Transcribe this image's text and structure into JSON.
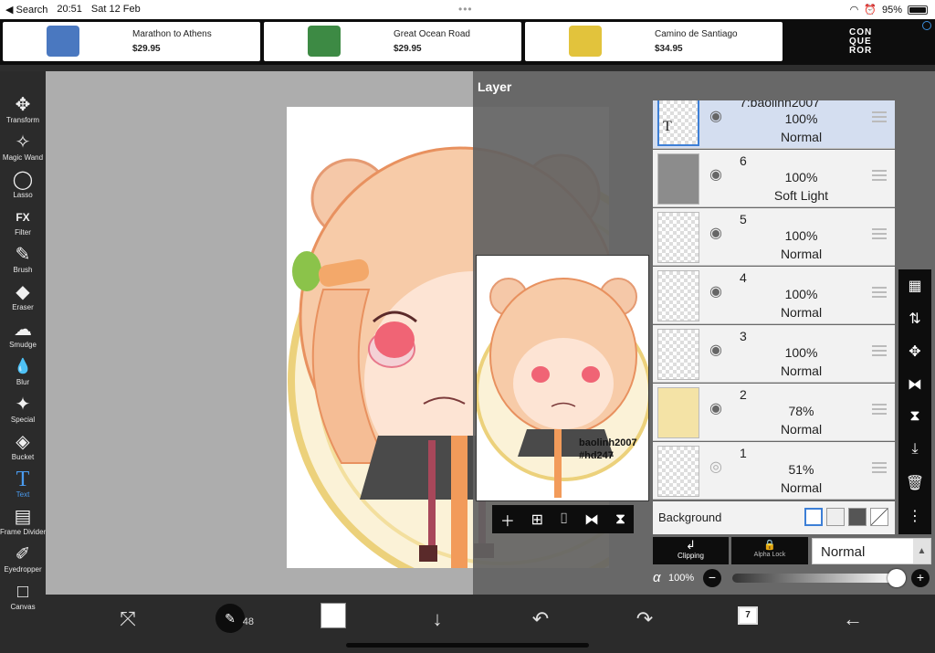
{
  "status_bar": {
    "back": "◀ Search",
    "time": "20:51",
    "date": "Sat 12 Feb",
    "battery": "95%"
  },
  "ads": [
    {
      "title": "Marathon to Athens",
      "price": "$29.95",
      "color": "#4a78c0"
    },
    {
      "title": "Great Ocean Road",
      "price": "$29.95",
      "color": "#3d8a44"
    },
    {
      "title": "Camino de Santiago",
      "price": "$34.95",
      "color": "#e2c33c"
    }
  ],
  "ad_brand": "CON QUE ROR",
  "tools": [
    {
      "label": "Transform",
      "icon": "✥"
    },
    {
      "label": "Magic Wand",
      "icon": "✧"
    },
    {
      "label": "Lasso",
      "icon": "◯"
    },
    {
      "label": "Filter",
      "icon": "FX"
    },
    {
      "label": "Brush",
      "icon": "✎"
    },
    {
      "label": "Eraser",
      "icon": "◆"
    },
    {
      "label": "Smudge",
      "icon": "☁"
    },
    {
      "label": "Blur",
      "icon": "💧"
    },
    {
      "label": "Special",
      "icon": "✦"
    },
    {
      "label": "Bucket",
      "icon": "◈"
    },
    {
      "label": "Text",
      "icon": "T"
    },
    {
      "label": "Frame Divider",
      "icon": "▤"
    },
    {
      "label": "Eyedropper",
      "icon": "✐"
    },
    {
      "label": "Canvas",
      "icon": "□"
    }
  ],
  "layer_panel": {
    "title": "Layer",
    "layers": [
      {
        "name": "7:baolinh2007",
        "opacity": "100%",
        "blend": "Normal",
        "selected": true
      },
      {
        "name": "6",
        "opacity": "100%",
        "blend": "Soft Light",
        "selected": false
      },
      {
        "name": "5",
        "opacity": "100%",
        "blend": "Normal",
        "selected": false
      },
      {
        "name": "4",
        "opacity": "100%",
        "blend": "Normal",
        "selected": false
      },
      {
        "name": "3",
        "opacity": "100%",
        "blend": "Normal",
        "selected": false
      },
      {
        "name": "2",
        "opacity": "78%",
        "blend": "Normal",
        "selected": false
      },
      {
        "name": "1",
        "opacity": "51%",
        "blend": "Normal",
        "selected": false
      }
    ],
    "background_label": "Background",
    "clipping_label": "Clipping",
    "alpha_lock_label": "Alpha Lock",
    "blend_mode": "Normal",
    "alpha_symbol": "α",
    "alpha_value": "100%",
    "alpha_fraction": 1.0
  },
  "canvas_signature": "baolinh2007\n#hd247",
  "bottom_bar": {
    "brush_size": "48",
    "layer_count": "7"
  }
}
